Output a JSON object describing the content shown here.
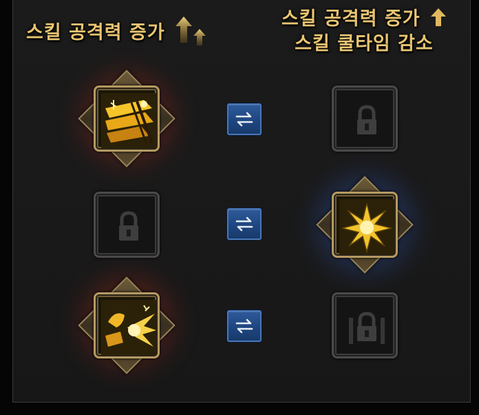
{
  "headers": {
    "left": "스킬 공격력 증가",
    "right_line1": "스킬 공격력 증가",
    "right_line2": "스킬 쿨타임 감소"
  },
  "rows": [
    {
      "left": {
        "state": "active",
        "icon": "golden-slash-skill-icon"
      },
      "swap": "swap-arrows-icon",
      "right": {
        "state": "locked",
        "icon": "lock-icon"
      }
    },
    {
      "left": {
        "state": "locked",
        "icon": "lock-icon"
      },
      "swap": "swap-arrows-icon",
      "right": {
        "state": "active",
        "icon": "starburst-skill-icon"
      }
    },
    {
      "left": {
        "state": "active",
        "icon": "golden-blast-skill-icon"
      },
      "swap": "swap-arrows-icon",
      "right": {
        "state": "locked",
        "icon": "pillared-lock-icon"
      }
    }
  ],
  "colors": {
    "header_text": "#e9c572",
    "active_frame": "#b59a62",
    "locked_frame": "#4a4a4a",
    "swap_button": "#1f467f",
    "left_glow": "#aa3728",
    "right_glow": "#3c6ebe"
  }
}
